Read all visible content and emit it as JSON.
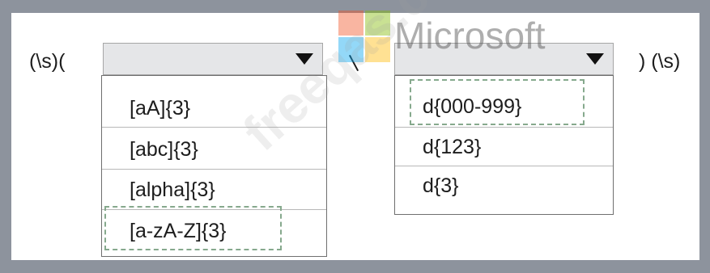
{
  "expression": {
    "prefix": "(\\s)(",
    "suffix": ") (\\s)"
  },
  "dropdown_left": {
    "selected_value": "",
    "options": [
      "[aA]{3}",
      "[abc]{3}",
      "[alpha]{3}",
      "[a-zA-Z]{3}"
    ],
    "highlighted_option": "[a-zA-Z]{3}"
  },
  "dropdown_right": {
    "selected_value": "",
    "options": [
      "d{000-999}",
      "d{123}",
      "d{3}"
    ],
    "highlighted_option": "d{000-999}"
  },
  "watermark": {
    "logo_text": "Microsoft",
    "site_text": "freeqas.com"
  },
  "colors": {
    "frame": "#8d939d",
    "dropdown_fill": "#e5e6e8",
    "selection_dashes": "#86a98d",
    "logo_red": "#f25022",
    "logo_green": "#7fba00",
    "logo_blue": "#00a4ef",
    "logo_yellow": "#ffb900"
  },
  "icons": {
    "dropdown_arrow": "triangle-down-icon",
    "logo": "microsoft-logo-icon"
  }
}
